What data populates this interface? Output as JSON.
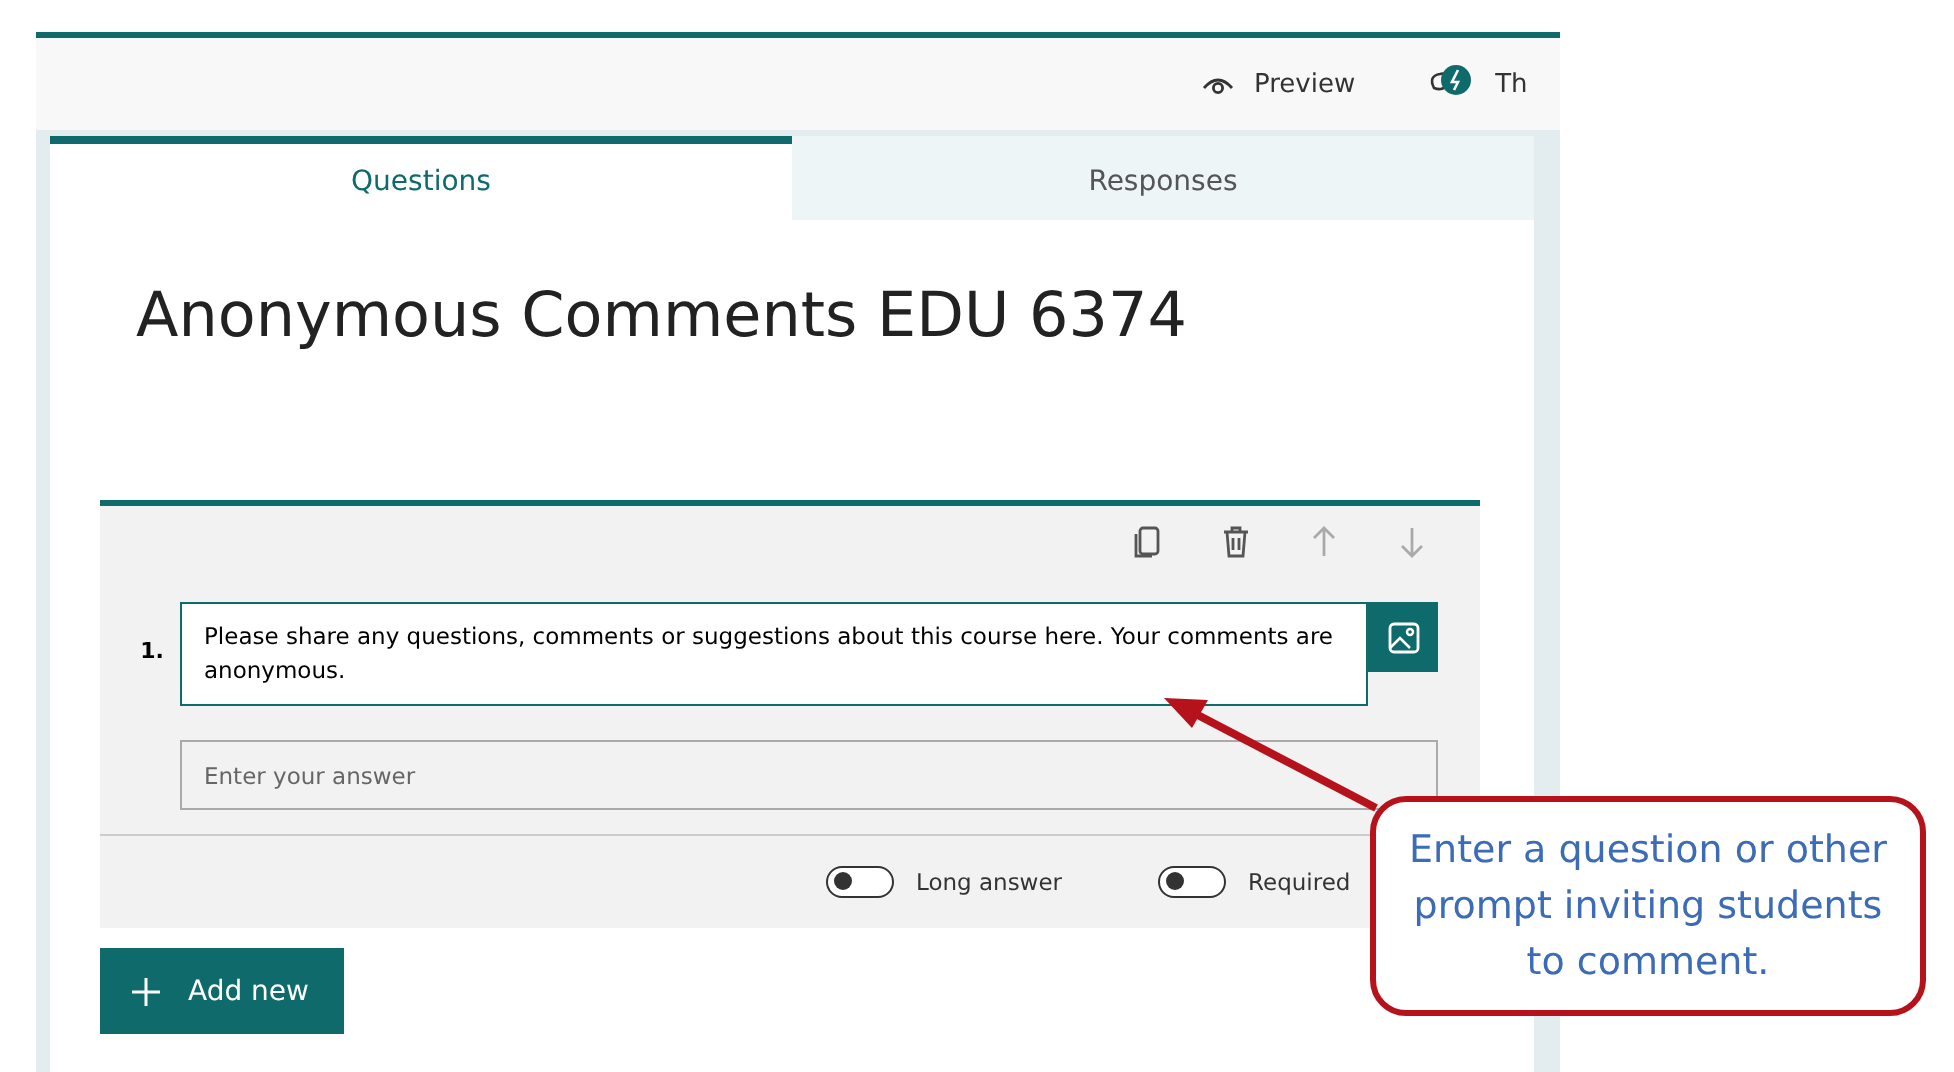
{
  "toolbar": {
    "items": [
      {
        "kind": "preview",
        "label": "Preview"
      },
      {
        "kind": "theme",
        "label": "Th"
      }
    ]
  },
  "tabs": [
    {
      "label": "Questions",
      "selected": true
    },
    {
      "label": "Responses",
      "selected": false
    }
  ],
  "form_title": "Anonymous Comments EDU 6374",
  "question": {
    "number": "1.",
    "text": "Please share any questions, comments or suggestions about this course here. Your comments are anonymous.",
    "placeholder": "Enter your answer",
    "toggles": [
      {
        "label": "Long answer",
        "on": false
      },
      {
        "label": "Required",
        "on": false
      }
    ]
  },
  "add_button": {
    "label": "Add new"
  },
  "callout": {
    "text": "Enter a question or other prompt inviting students to comment."
  }
}
